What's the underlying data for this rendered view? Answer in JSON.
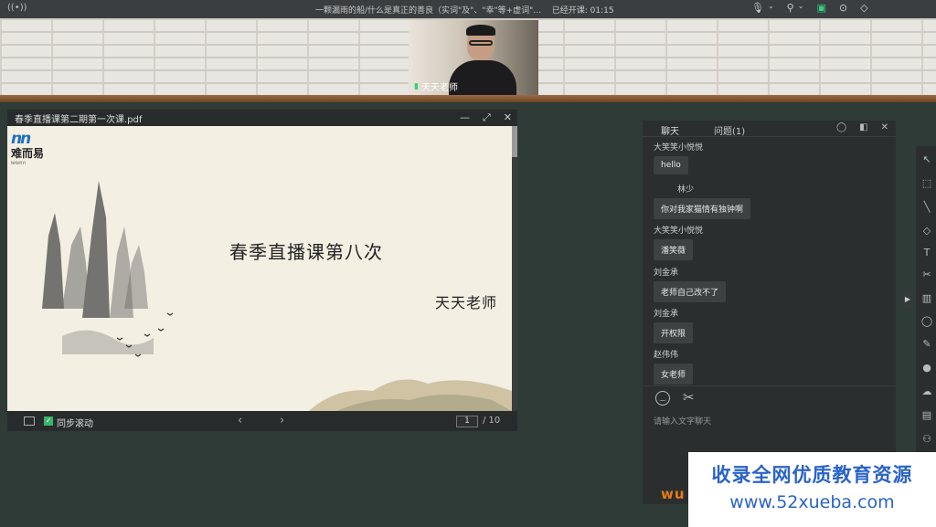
{
  "topbar": {
    "title": "一颗漏雨的船/什么是真正的善良（实词\"及\"、\"幸\"等+虚词\"…",
    "timer_text": "已经开课: 01:15"
  },
  "webcam": {
    "name": "天天老师"
  },
  "pdf": {
    "filename": "春季直播课第二期第一次课.pdf",
    "logo_brand": "难而易",
    "logo_sub": "NANYIYI",
    "slide_title": "春季直播课第八次",
    "slide_author": "天天老师",
    "sync_label": "同步滚动",
    "page_current": "1",
    "page_total": "/ 10"
  },
  "chat": {
    "tab_chat": "聊天",
    "tab_questions": "问题(1)",
    "messages": [
      {
        "name": "大笑笑小悦悦",
        "text": "hello"
      },
      {
        "name": "林少",
        "text": "你对我家猫情有独钟啊"
      },
      {
        "name": "大笑笑小悦悦",
        "text": "潘笑薇"
      },
      {
        "name": "刘金承",
        "text": "老师自己改不了"
      },
      {
        "name": "刘金承",
        "text": "开权限"
      },
      {
        "name": "赵伟伟",
        "text": "女老师"
      }
    ],
    "input_placeholder": "请输入文字聊天",
    "brand_fragment": "wu"
  },
  "banner": {
    "line1": "收录全网优质教育资源",
    "line2": "www.52xueba.com"
  },
  "colors": {
    "board": "#2e3b37",
    "accent_green": "#35d07f",
    "banner_blue": "#2a63c9"
  }
}
